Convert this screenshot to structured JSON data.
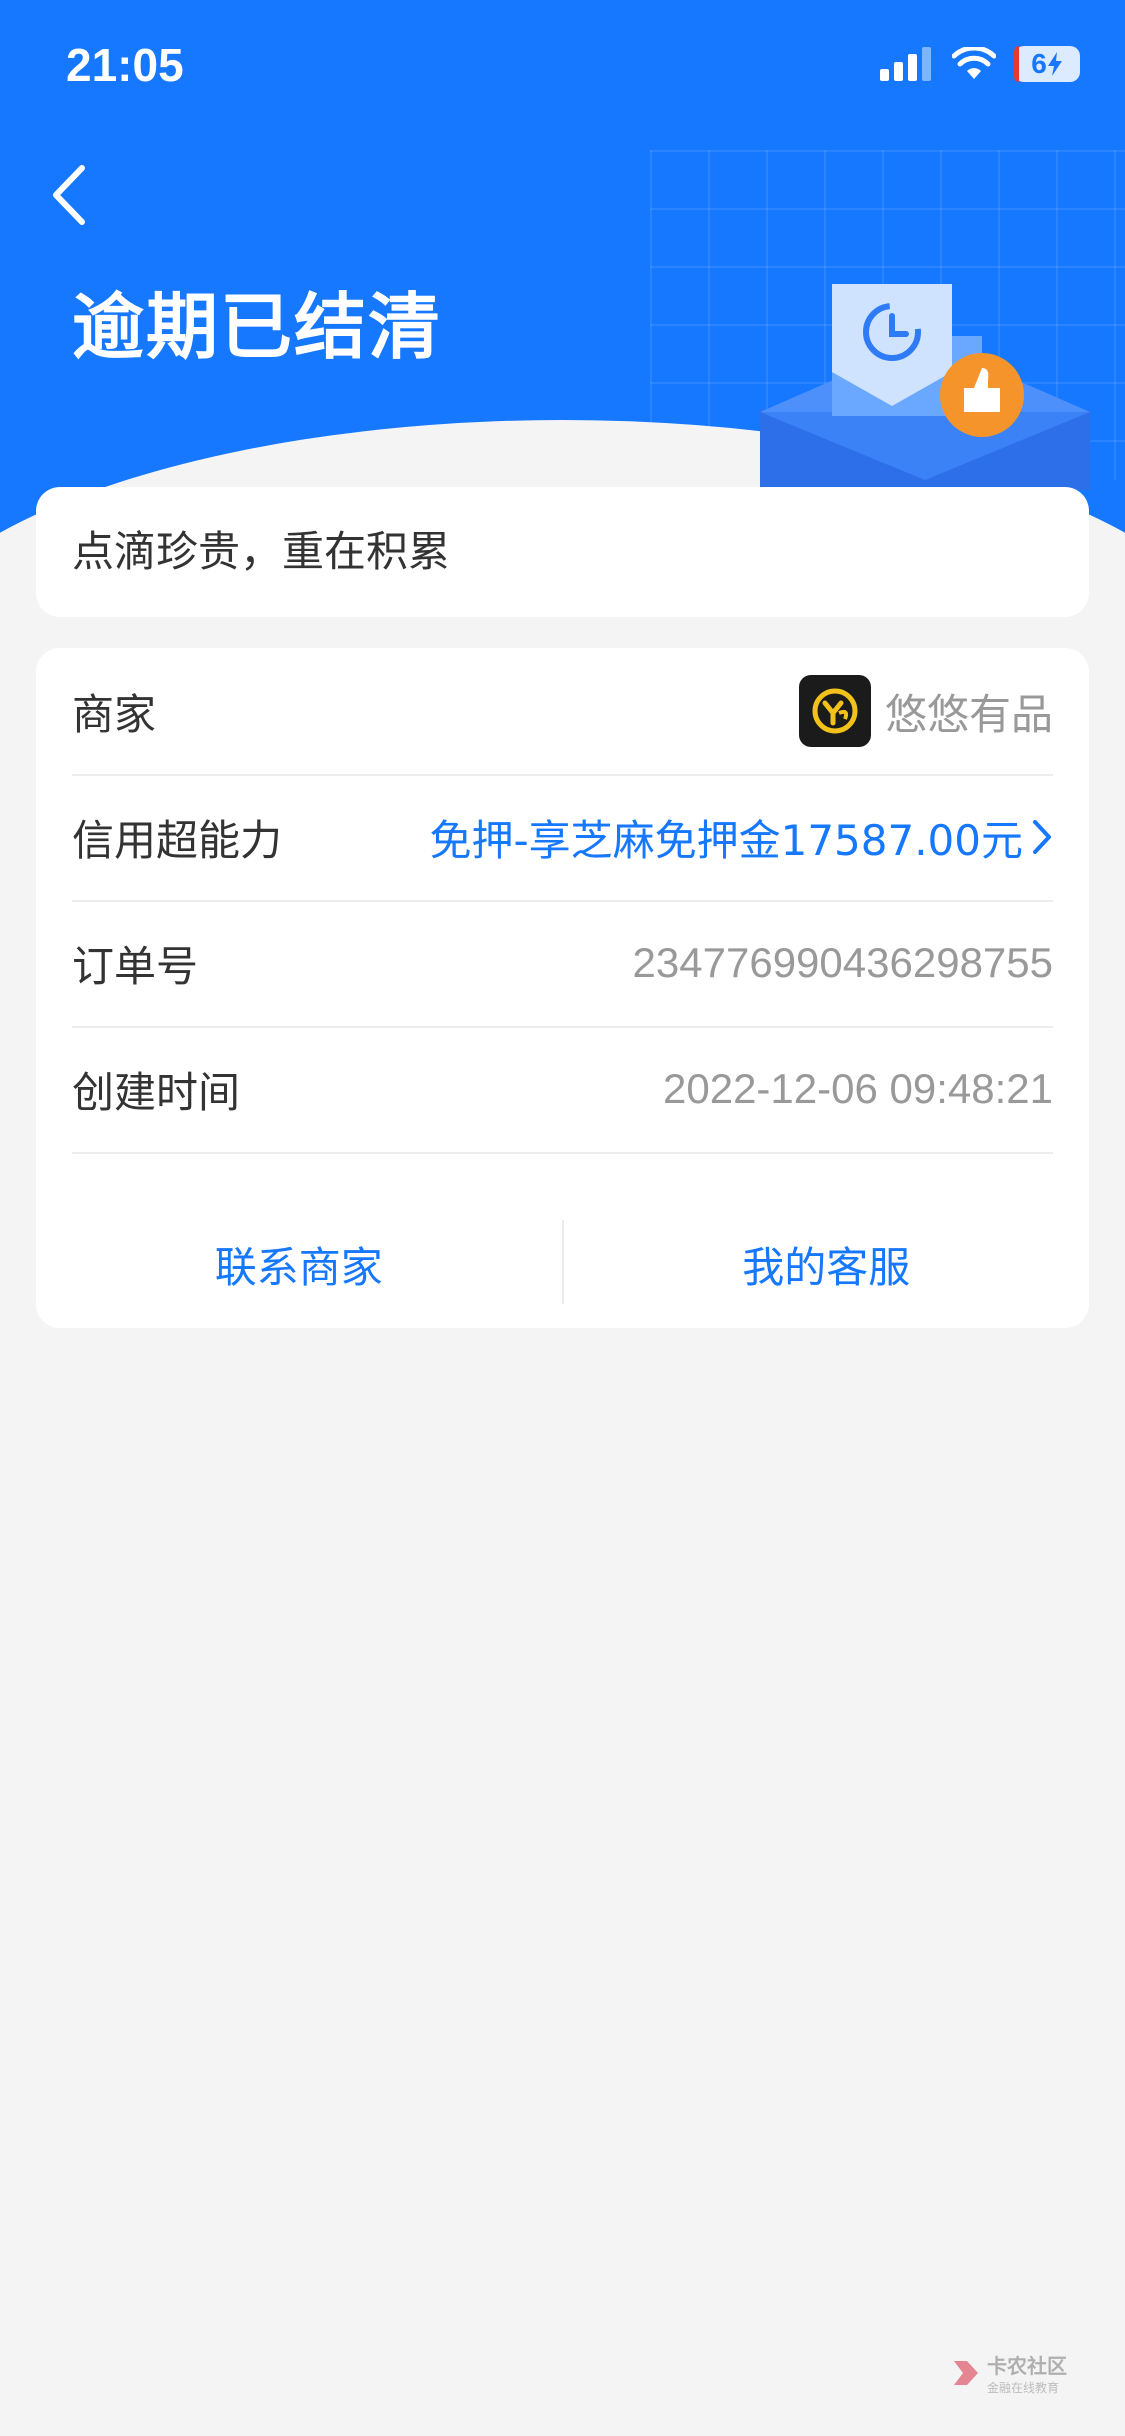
{
  "status_bar": {
    "time": "21:05",
    "battery": "6"
  },
  "header": {
    "title": "逾期已结清"
  },
  "slogan": "点滴珍贵，重在积累",
  "info": {
    "merchant_label": "商家",
    "merchant_name": "悠悠有品",
    "credit_label": "信用超能力",
    "credit_value": "免押-享芝麻免押金17587.00元",
    "order_label": "订单号",
    "order_value": "234776990436298755",
    "created_label": "创建时间",
    "created_value": "2022-12-06 09:48:21"
  },
  "actions": {
    "contact_merchant": "联系商家",
    "customer_service": "我的客服"
  },
  "watermark": {
    "title": "卡农社区",
    "subtitle": "金融在线教育"
  },
  "colors": {
    "primary": "#1677ff",
    "background": "#f4f4f4",
    "card": "#ffffff",
    "accent_orange": "#f5942a"
  }
}
